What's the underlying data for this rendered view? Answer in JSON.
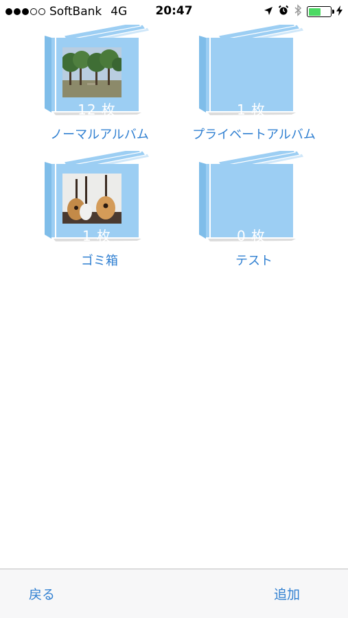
{
  "status_bar": {
    "carrier": "SoftBank",
    "network": "4G",
    "time": "20:47",
    "signal_bars_filled": 3,
    "signal_bars_total": 5,
    "battery_level_percent": 55,
    "battery_color": "#4cd964",
    "icons": [
      "location-arrow-icon",
      "alarm-clock-icon",
      "bluetooth-icon",
      "battery-icon",
      "charging-bolt-icon"
    ]
  },
  "albums": [
    {
      "name": "ノーマルアルバム",
      "count": "12 枚",
      "thumbnail": "trees-photo"
    },
    {
      "name": "プライベートアルバム",
      "count": "1 枚",
      "thumbnail": ""
    },
    {
      "name": "ゴミ箱",
      "count": "1 枚",
      "thumbnail": "guitars-photo"
    },
    {
      "name": "テスト",
      "count": "0 枚",
      "thumbnail": ""
    }
  ],
  "toolbar": {
    "back_label": "戻る",
    "add_label": "追加"
  },
  "colors": {
    "accent": "#2f7fd1",
    "album_cover": "#9ccef3",
    "album_pages": "#7fbde9"
  }
}
